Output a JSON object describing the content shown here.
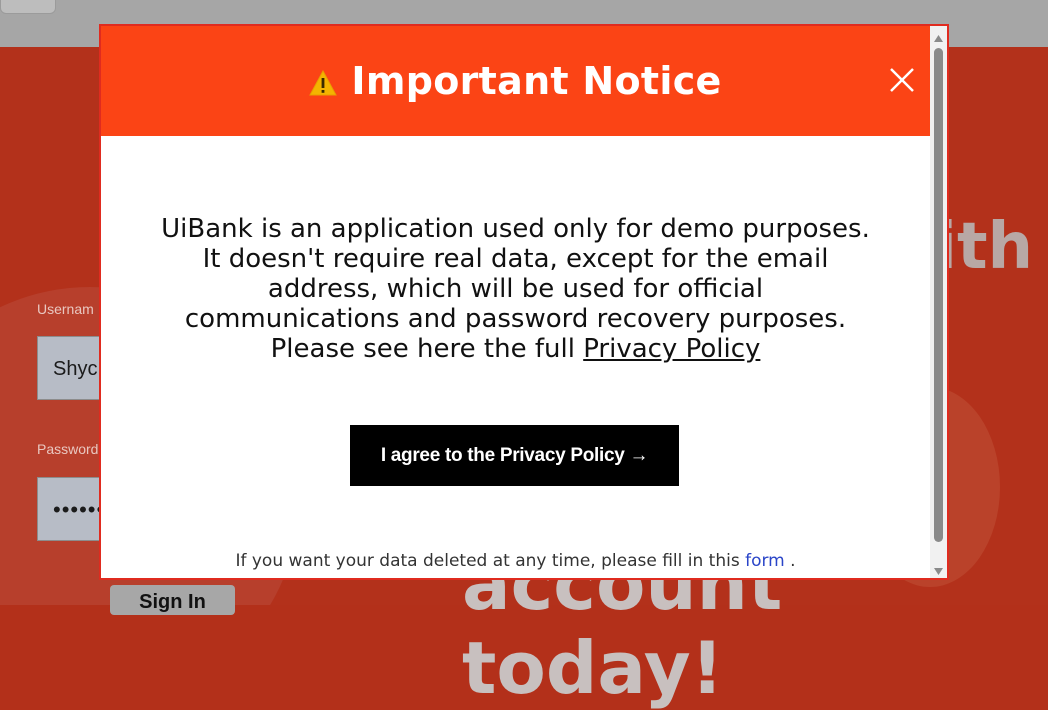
{
  "background": {
    "username_label": "Usernam",
    "username_value": "Shyc",
    "password_label": "Password",
    "password_value": "••••••",
    "signin_label": "Sign In",
    "heading_with": "ith",
    "heading_today": "account today!"
  },
  "modal": {
    "warning_icon": "warning-icon",
    "title": "Important Notice",
    "close_icon": "close-icon",
    "notice_lines": [
      "UiBank is an application used only for demo purposes.",
      "It doesn't require real data, except for the email",
      "address, which will be used for official",
      "communications and password recovery purposes."
    ],
    "notice_last_prefix": "Please see here the full ",
    "privacy_link": "Privacy Policy",
    "agree_button": "I agree to the Privacy Policy →",
    "footer_prefix": "If you want your data deleted at any time, please fill in this ",
    "footer_link": "form",
    "footer_suffix": " ."
  },
  "colors": {
    "header": "#fb4415",
    "modal_border": "#e02b1f",
    "button": "#000000",
    "link": "#2a45c8",
    "page_background": "#b3311b"
  }
}
